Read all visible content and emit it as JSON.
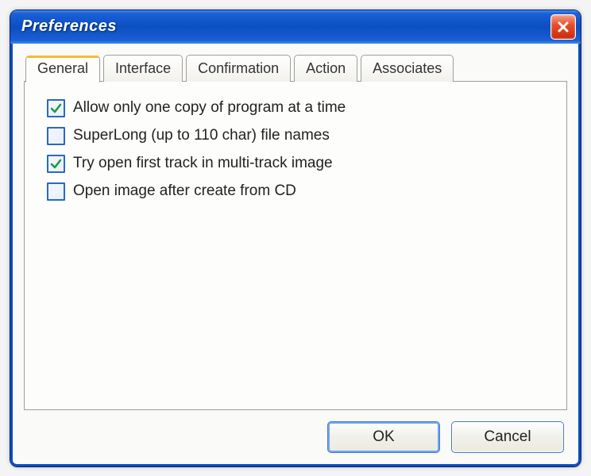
{
  "window": {
    "title": "Preferences"
  },
  "tabs": {
    "general": "General",
    "interface": "Interface",
    "confirmation": "Confirmation",
    "action": "Action",
    "associates": "Associates",
    "active": "general"
  },
  "options": {
    "allow_one_copy": {
      "label": "Allow only one copy of program at a time",
      "checked": true
    },
    "superlong": {
      "label": "SuperLong (up to 110 char) file names",
      "checked": false
    },
    "try_open_first": {
      "label": "Try open first track in multi-track image",
      "checked": true
    },
    "open_after_create": {
      "label": "Open image after create from CD",
      "checked": false
    }
  },
  "buttons": {
    "ok": "OK",
    "cancel": "Cancel"
  },
  "icons": {
    "close": "close-icon"
  }
}
